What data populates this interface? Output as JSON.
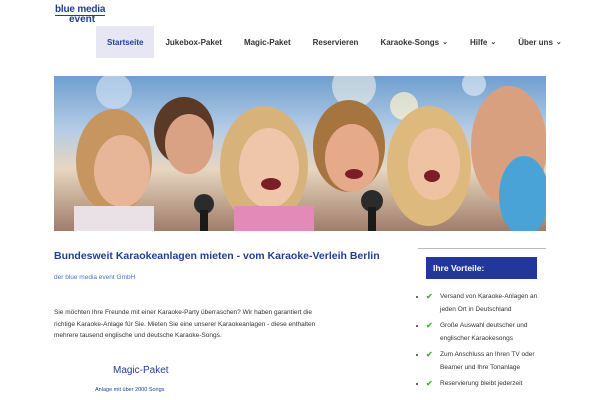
{
  "logo": {
    "line1": "blue media",
    "line2": "event"
  },
  "nav": {
    "items": [
      {
        "label": "Startseite",
        "active": true,
        "dropdown": false
      },
      {
        "label": "Jukebox-Paket",
        "active": false,
        "dropdown": false
      },
      {
        "label": "Magic-Paket",
        "active": false,
        "dropdown": false
      },
      {
        "label": "Reservieren",
        "active": false,
        "dropdown": false
      },
      {
        "label": "Karaoke-Songs",
        "active": false,
        "dropdown": true
      },
      {
        "label": "Hilfe",
        "active": false,
        "dropdown": true
      },
      {
        "label": "Über uns",
        "active": false,
        "dropdown": true
      }
    ],
    "chevron_icon": "chevron-down-icon"
  },
  "main": {
    "title": "Bundesweit Karaokeanlagen mieten - vom Karaoke-Verleih Berlin",
    "subtitle": "der blue media event GmbH",
    "body_lines": [
      "Sie möchten Ihre Freunde mit einer Karaoke-Party überraschen? Wir haben garantiert die",
      "richtige Karaoke-Anlage für Sie. Mieten Sie eine unserer Karaokeanlagen - diese enthalten",
      "mehrere tausend englische und deutsche Karaoke-Songs."
    ],
    "package_title": "Magic-Paket",
    "package_sub": "Anlage mit über 2000 Songs"
  },
  "sidebar": {
    "heading": "Ihre Vorteile:",
    "items": [
      "Versand von Karaoke-Anlagen an jeden Ort in Deutschland",
      "Große Auswahl deutscher und englischer Karaokesongs",
      "Zum Anschluss an Ihren TV oder Beamer und Ihre Tonanlage",
      "Reservierung bleibt jederzeit"
    ],
    "check_icon": "check-icon"
  },
  "colors": {
    "brand": "#1f3f97",
    "sidebar_box": "#22379a",
    "check": "#4caf3e",
    "active_nav_bg": "#e6e7f2"
  }
}
